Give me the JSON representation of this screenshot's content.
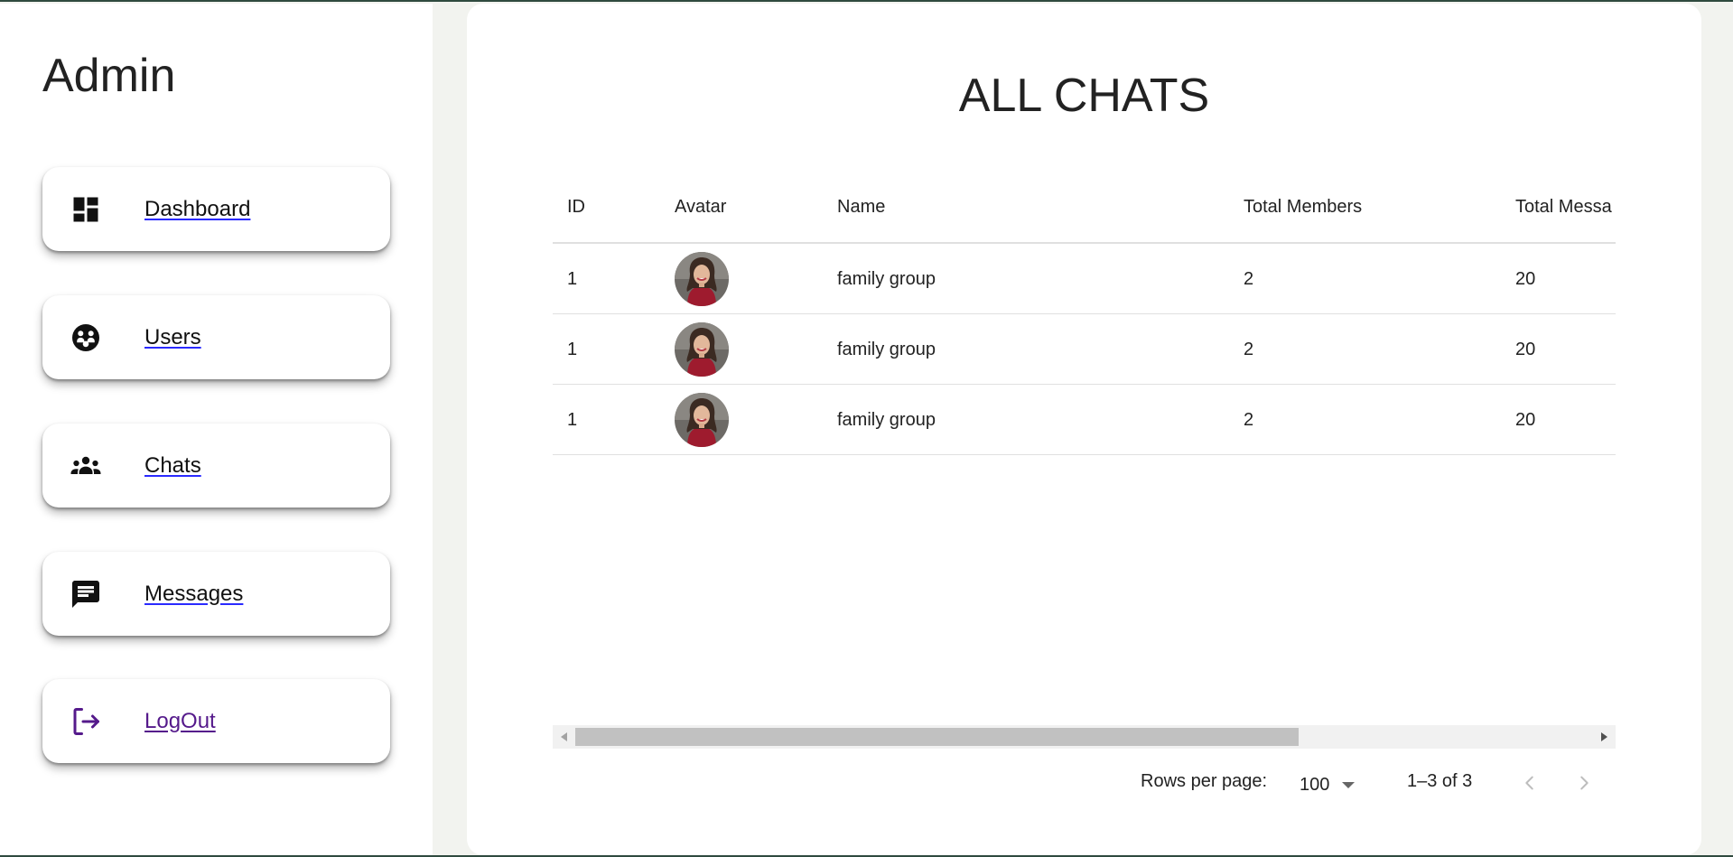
{
  "sidebar": {
    "title": "Admin",
    "items": [
      {
        "label": "Dashboard",
        "icon": "dashboard-icon"
      },
      {
        "label": "Users",
        "icon": "users-icon"
      },
      {
        "label": "Chats",
        "icon": "groups-icon"
      },
      {
        "label": "Messages",
        "icon": "message-icon"
      },
      {
        "label": "LogOut",
        "icon": "logout-icon"
      }
    ]
  },
  "main": {
    "title": "ALL CHATS",
    "table": {
      "columns": [
        "ID",
        "Avatar",
        "Name",
        "Total Members",
        "Total Messa"
      ],
      "rows": [
        {
          "id": "1",
          "name": "family group",
          "members": "2",
          "messages": "20"
        },
        {
          "id": "1",
          "name": "family group",
          "members": "2",
          "messages": "20"
        },
        {
          "id": "1",
          "name": "family group",
          "members": "2",
          "messages": "20"
        }
      ]
    },
    "pagination": {
      "rows_per_page_label": "Rows per page:",
      "rows_per_page_value": "100",
      "range": "1–3 of 3"
    }
  },
  "colors": {
    "frame": "#2f4a3f",
    "background": "#f2f3ef",
    "logout_accent": "#551a8b",
    "link_underline": "#2a2aff"
  }
}
